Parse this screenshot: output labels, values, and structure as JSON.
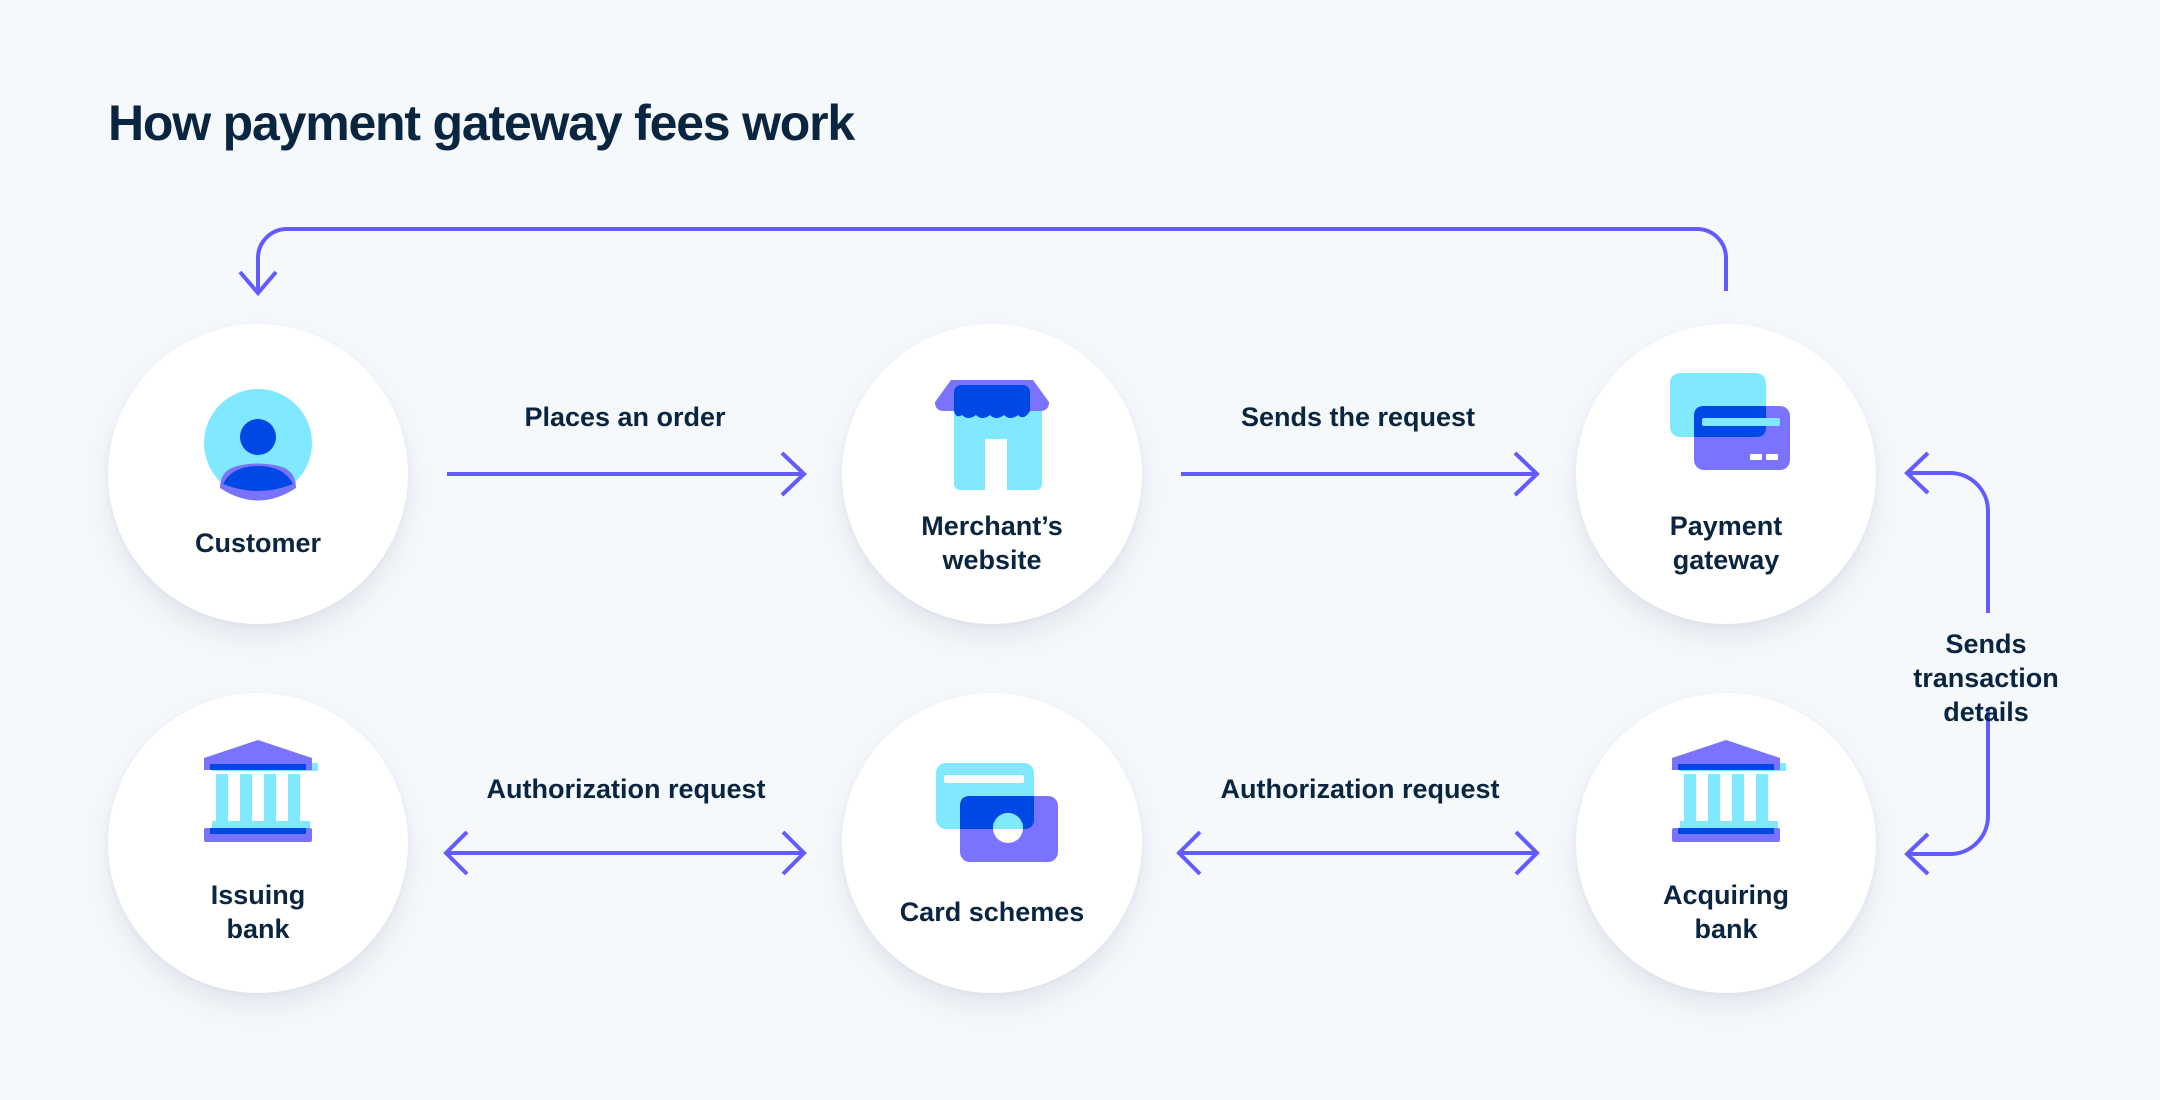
{
  "title": "How payment gateway fees work",
  "colors": {
    "background": "#F6F9FC",
    "text": "#0A2540",
    "arrow": "#635BFF",
    "icon_cyan": "#80E9FF",
    "icon_blue": "#0048E5",
    "icon_purple": "#7A73FF"
  },
  "nodes": {
    "customer": {
      "label": "Customer",
      "icon": "user-icon"
    },
    "merchant": {
      "label": "Merchant’s\nwebsite",
      "icon": "storefront-icon"
    },
    "gateway": {
      "label": "Payment\ngateway",
      "icon": "credit-cards-icon"
    },
    "issuing": {
      "label": "Issuing\nbank",
      "icon": "bank-icon"
    },
    "schemes": {
      "label": "Card schemes",
      "icon": "card-scheme-icon"
    },
    "acquiring": {
      "label": "Acquiring\nbank",
      "icon": "bank-icon"
    }
  },
  "edges": {
    "places_order": "Places an order",
    "sends_request": "Sends the request",
    "auth_left": "Authorization request",
    "auth_right": "Authorization request",
    "transaction_details": "Sends transaction\ndetails"
  }
}
